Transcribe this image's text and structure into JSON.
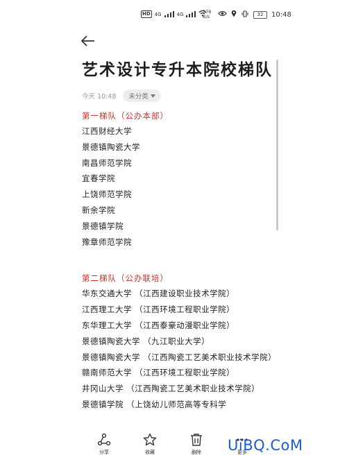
{
  "status_bar": {
    "badge": "HD",
    "sim1": "4G",
    "sim2": "4G",
    "network_speed": "378 B/s",
    "battery": "32",
    "time": "10:48"
  },
  "note": {
    "title": "艺术设计专升本院校梯队",
    "date": "今天 10:48",
    "category": "未分类",
    "sections": [
      {
        "heading": "第一梯队（公办本部）",
        "items": [
          "江西财经大学",
          "景德镇陶瓷大学",
          "南昌师范学院",
          "宜春学院",
          "上饶师范学院",
          "新余学院",
          "景德镇学院",
          "豫章师范学院"
        ]
      },
      {
        "heading": "第二梯队（公办联培）",
        "items": [
          "华东交通大学 （江西建设职业技术学院）",
          "江西理工大学 （江西环境工程职业学院）",
          "东华理工大学 （江西泰豪动漫职业学院）",
          "景德镇陶瓷大学 （九江职业大学）",
          "景德镇陶瓷大学 （江西陶瓷工艺美术职业技术学院）",
          "赣南师范大学 （江西环境工程职业学院）",
          "井冈山大学 （江西陶瓷工艺美术职业技术学院）",
          "景德镇学院 （上饶幼儿师范高等专科学"
        ]
      }
    ]
  },
  "toolbar": {
    "share": "分享",
    "favorite": "收藏",
    "delete": "删除",
    "more": "更多"
  },
  "watermark": "UiBQ.CoM"
}
